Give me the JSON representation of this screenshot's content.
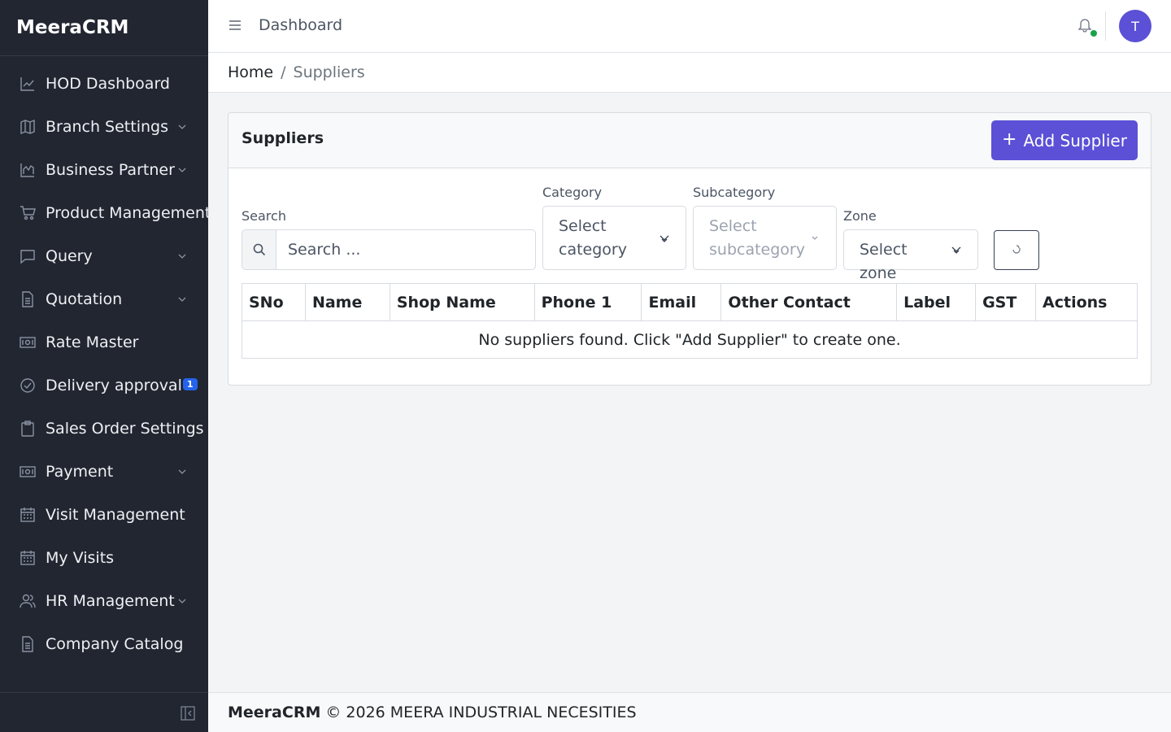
{
  "app": {
    "brand": "MeeraCRM"
  },
  "sidebar": {
    "items": [
      {
        "label": "HOD Dashboard",
        "icon": "chart-line-icon",
        "has_submenu": false
      },
      {
        "label": "Branch Settings",
        "icon": "map-icon",
        "has_submenu": true
      },
      {
        "label": "Business Partner",
        "icon": "building-chart-icon",
        "has_submenu": true
      },
      {
        "label": "Product Management",
        "icon": "cart-icon",
        "has_submenu": false
      },
      {
        "label": "Query",
        "icon": "chat-icon",
        "has_submenu": true
      },
      {
        "label": "Quotation",
        "icon": "document-icon",
        "has_submenu": true
      },
      {
        "label": "Rate Master",
        "icon": "money-icon",
        "has_submenu": false
      },
      {
        "label": "Delivery approval",
        "icon": "check-circle-icon",
        "has_submenu": false,
        "badge": "1"
      },
      {
        "label": "Sales Order Settings",
        "icon": "clipboard-icon",
        "has_submenu": false
      },
      {
        "label": "Payment",
        "icon": "money-icon",
        "has_submenu": true
      },
      {
        "label": "Visit Management",
        "icon": "calendar-icon",
        "has_submenu": false
      },
      {
        "label": "My Visits",
        "icon": "calendar-icon",
        "has_submenu": false
      },
      {
        "label": "HR Management",
        "icon": "people-icon",
        "has_submenu": true
      },
      {
        "label": "Company Catalog",
        "icon": "document-icon",
        "has_submenu": false
      }
    ]
  },
  "header": {
    "title": "Dashboard",
    "avatar_initial": "T",
    "notification_status_color": "#16a34a"
  },
  "breadcrumb": {
    "home": "Home",
    "separator": "/",
    "current": "Suppliers"
  },
  "card": {
    "title": "Suppliers",
    "add_button": {
      "icon": "plus-icon",
      "label": "Add Supplier"
    }
  },
  "filters": {
    "search": {
      "label": "Search",
      "placeholder": "Search ..."
    },
    "category": {
      "label": "Category",
      "selected": "Select category"
    },
    "subcategory": {
      "label": "Subcategory",
      "selected": "Select subcategory",
      "disabled": true
    },
    "zone": {
      "label": "Zone",
      "selected": "Select zone"
    },
    "reset_icon": "reset-icon"
  },
  "table": {
    "columns": [
      "SNo",
      "Name",
      "Shop Name",
      "Phone 1",
      "Email",
      "Other Contact",
      "Label",
      "GST",
      "Actions"
    ],
    "empty_message": "No suppliers found. Click \"Add Supplier\" to create one."
  },
  "footer": {
    "brand": "MeeraCRM",
    "copyright": "© 2026 MEERA INDUSTRIAL NECESITIES"
  },
  "colors": {
    "sidebar_bg": "#212631",
    "primary": "#5b50d6",
    "badge": "#2563eb"
  }
}
